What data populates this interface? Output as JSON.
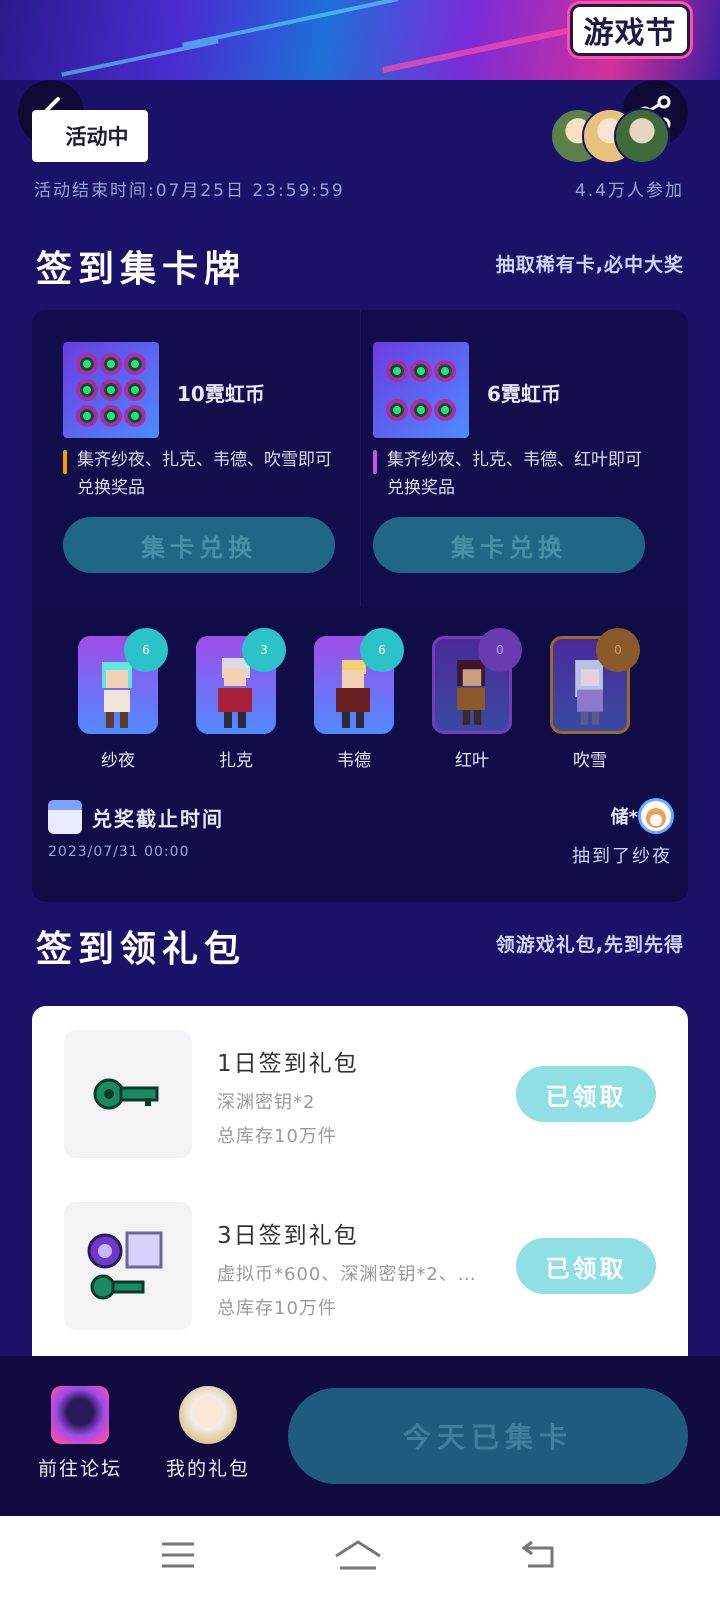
{
  "banner": {
    "logo_text": "游戏节"
  },
  "activity": {
    "status": "活动中",
    "end_time": "活动结束时间:07月25日 23:59:59",
    "participants": "4.4万人参加"
  },
  "card_section": {
    "title": "签到集卡牌",
    "subtitle": "抽取稀有卡,必中大奖",
    "prizes": [
      {
        "name": "10霓虹币",
        "desc": "集齐纱夜、扎克、韦德、吹雪即可兑换奖品",
        "button": "集卡兑换",
        "accent": "#f2a000"
      },
      {
        "name": "6霓虹币",
        "desc": "集齐纱夜、扎克、韦德、红叶即可兑换奖品",
        "button": "集卡兑换",
        "accent": "#c058e0"
      }
    ],
    "characters": [
      {
        "name": "纱夜",
        "count": "6"
      },
      {
        "name": "扎克",
        "count": "3"
      },
      {
        "name": "韦德",
        "count": "6"
      },
      {
        "name": "红叶",
        "count": "0"
      },
      {
        "name": "吹雪",
        "count": "0"
      }
    ],
    "deadline_label": "兑奖截止时间",
    "deadline_date": "2023/07/31 00:00",
    "winner_user": "储*",
    "winner_text": "抽到了纱夜"
  },
  "gift_section": {
    "title": "签到领礼包",
    "subtitle": "领游戏礼包,先到先得",
    "gifts": [
      {
        "title": "1日签到礼包",
        "items": "深渊密钥*2",
        "stock": "总库存10万件",
        "button": "已领取"
      },
      {
        "title": "3日签到礼包",
        "items": "虚拟币*600、深渊密钥*2、…",
        "stock": "总库存10万件",
        "button": "已领取"
      }
    ]
  },
  "bottom_bar": {
    "forum_label": "前往论坛",
    "gift_label": "我的礼包",
    "today_button": "今天已集卡"
  },
  "colors": {
    "background": "#1a1268",
    "claimed_button": "#8fdfe4",
    "disabled_button": "#1f6784"
  }
}
